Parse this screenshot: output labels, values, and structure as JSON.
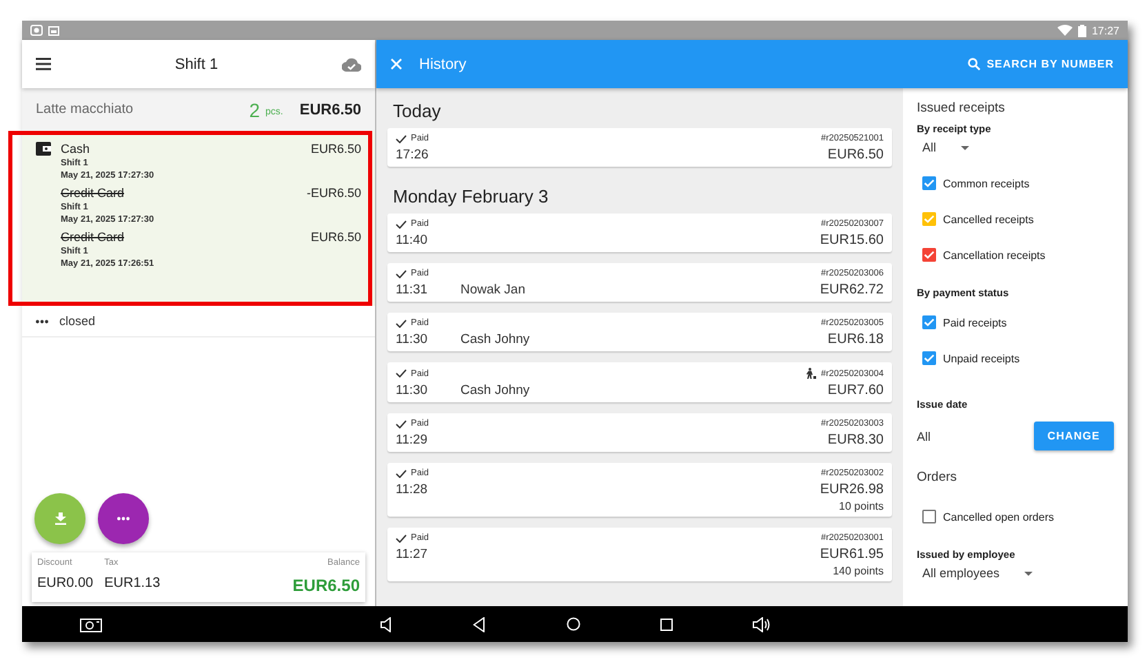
{
  "status_bar": {
    "time": "17:27"
  },
  "shift_panel": {
    "title": "Shift 1",
    "product": {
      "name": "Latte macchiato",
      "quantity": "2",
      "unit": "pcs.",
      "price": "EUR6.50"
    },
    "payments_highlighted": true,
    "payments": [
      {
        "method": "Cash",
        "shift": "Shift 1",
        "date": "May 21, 2025 17:27:30",
        "amount": "EUR6.50",
        "cancelled": false,
        "current": true
      },
      {
        "method": "Credit Card",
        "shift": "Shift 1",
        "date": "May 21, 2025 17:27:30",
        "amount": "-EUR6.50",
        "cancelled": true,
        "current": false
      },
      {
        "method": "Credit Card",
        "shift": "Shift 1",
        "date": "May 21, 2025 17:26:51",
        "amount": "EUR6.50",
        "cancelled": true,
        "current": false
      }
    ],
    "state": "closed",
    "summary": [
      {
        "label": "Discount",
        "value": "EUR0.00",
        "emphasis": false
      },
      {
        "label": "Tax",
        "value": "EUR1.13",
        "emphasis": false
      },
      {
        "label": "Balance",
        "value": "EUR6.50",
        "emphasis": true
      }
    ]
  },
  "history": {
    "title": "History",
    "search": "SEARCH BY NUMBER",
    "groups": [
      {
        "heading": "Today",
        "receipts": [
          {
            "status": "Paid",
            "number": "#r20250521001",
            "time": "17:26",
            "amount": "EUR6.50",
            "customer_icon": false
          }
        ]
      },
      {
        "heading": "Monday February 3",
        "receipts": [
          {
            "status": "Paid",
            "number": "#r20250203007",
            "time": "11:40",
            "amount": "EUR15.60",
            "customer_icon": false
          },
          {
            "status": "Paid",
            "number": "#r20250203006",
            "time": "11:31",
            "customer": "Nowak Jan",
            "amount": "EUR62.72",
            "customer_icon": false
          },
          {
            "status": "Paid",
            "number": "#r20250203005",
            "time": "11:30",
            "customer": "Cash Johny",
            "amount": "EUR6.18",
            "customer_icon": false
          },
          {
            "status": "Paid",
            "number": "#r20250203004",
            "time": "11:30",
            "customer": "Cash Johny",
            "amount": "EUR7.60",
            "customer_icon": true
          },
          {
            "status": "Paid",
            "number": "#r20250203003",
            "time": "11:29",
            "amount": "EUR8.30",
            "customer_icon": false
          },
          {
            "status": "Paid",
            "number": "#r20250203002",
            "time": "11:28",
            "amount": "EUR26.98",
            "points": "10 points",
            "customer_icon": false
          },
          {
            "status": "Paid",
            "number": "#r20250203001",
            "time": "11:27",
            "amount": "EUR61.95",
            "points": "140 points",
            "customer_icon": false
          }
        ]
      }
    ]
  },
  "filters": [
    {
      "kind": "title",
      "text": "Issued receipts"
    },
    {
      "kind": "label",
      "text": "By receipt type"
    },
    {
      "kind": "dropdown",
      "value": "All"
    },
    {
      "kind": "checkbox",
      "text": "Common receipts",
      "checked": true,
      "color": "#2196f3"
    },
    {
      "kind": "checkbox",
      "text": "Cancelled receipts",
      "checked": true,
      "color": "#ffc107"
    },
    {
      "kind": "checkbox",
      "text": "Cancellation receipts",
      "checked": true,
      "color": "#f44336"
    },
    {
      "kind": "label",
      "text": "By payment status"
    },
    {
      "kind": "checkbox",
      "text": "Paid receipts",
      "checked": true,
      "color": "#2196f3"
    },
    {
      "kind": "checkbox",
      "text": "Unpaid receipts",
      "checked": true,
      "color": "#2196f3"
    },
    {
      "kind": "label",
      "text": "Issue date"
    },
    {
      "kind": "date",
      "value": "All",
      "button": "CHANGE"
    },
    {
      "kind": "title",
      "text": "Orders"
    },
    {
      "kind": "checkbox",
      "text": "Cancelled open orders",
      "checked": false
    },
    {
      "kind": "label",
      "text": "Issued by employee"
    },
    {
      "kind": "dropdown",
      "value": "All employees"
    }
  ]
}
